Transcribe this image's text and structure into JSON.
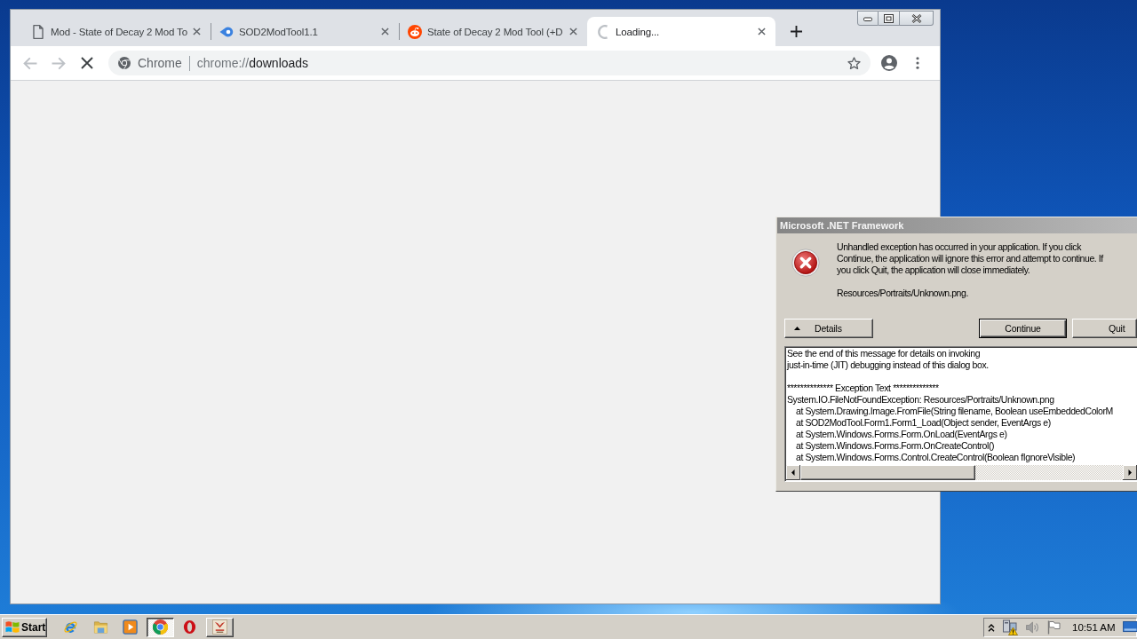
{
  "browser": {
    "tabs": [
      {
        "title": "Mod - State of Decay 2 Mod To",
        "kind": "page",
        "selected": false
      },
      {
        "title": "SOD2ModTool1.1",
        "kind": "comet",
        "selected": false
      },
      {
        "title": "State of Decay 2 Mod Tool (+D",
        "kind": "alien",
        "selected": false
      },
      {
        "title": "Loading...",
        "kind": "spinner",
        "selected": true
      }
    ],
    "can_go_back": false,
    "can_go_forward": false,
    "loading": true,
    "address": {
      "chip": "Chrome",
      "scheme": "chrome://",
      "path": "downloads"
    }
  },
  "dialog": {
    "title": "Microsoft .NET Framework",
    "message_lines": [
      "Unhandled exception has occurred in your application. If you click",
      "Continue, the application will ignore this error and attempt to continue. If",
      "you click Quit, the application will close immediately."
    ],
    "detail": "Resources/Portraits/Unknown.png.",
    "buttons": [
      {
        "kind": "details",
        "label": "Details",
        "default": false
      },
      {
        "kind": "continue",
        "label": "Continue",
        "default": true
      },
      {
        "kind": "quit",
        "label": "Quit",
        "default": false
      }
    ],
    "details_expanded": true,
    "details_text": [
      {
        "lines": [
          {
            "kind": "text",
            "text": "See the end of this message for details on invoking"
          },
          {
            "kind": "text",
            "text": "just-in-time (JIT) debugging instead of this dialog box."
          }
        ]
      },
      {
        "lines": [
          {
            "kind": "text",
            "text": "************** Exception Text **************"
          },
          {
            "kind": "text",
            "text": "System.IO.FileNotFoundException: Resources/Portraits/Unknown.png"
          },
          {
            "kind": "stack",
            "text": "at System.Drawing.Image.FromFile(String filename, Boolean useEmbeddedColorM"
          },
          {
            "kind": "stack",
            "text": "at SOD2ModTool.Form1.Form1_Load(Object sender, EventArgs e)"
          },
          {
            "kind": "stack",
            "text": "at System.Windows.Forms.Form.OnLoad(EventArgs e)"
          },
          {
            "kind": "stack",
            "text": "at System.Windows.Forms.Form.OnCreateControl()"
          },
          {
            "kind": "stack",
            "text": "at System.Windows.Forms.Control.CreateControl(Boolean fIgnoreVisible)"
          }
        ]
      }
    ]
  },
  "taskbar": {
    "start": "Start",
    "items": [
      {
        "kind": "ie",
        "running": false,
        "selected": false
      },
      {
        "kind": "explorer",
        "running": false,
        "selected": false
      },
      {
        "kind": "media",
        "running": false,
        "selected": false
      },
      {
        "kind": "chrome",
        "running": true,
        "selected": true
      },
      {
        "kind": "opera",
        "running": false,
        "selected": false
      },
      {
        "kind": "app",
        "running": true,
        "selected": false
      }
    ],
    "clock": "10:51 AM"
  }
}
